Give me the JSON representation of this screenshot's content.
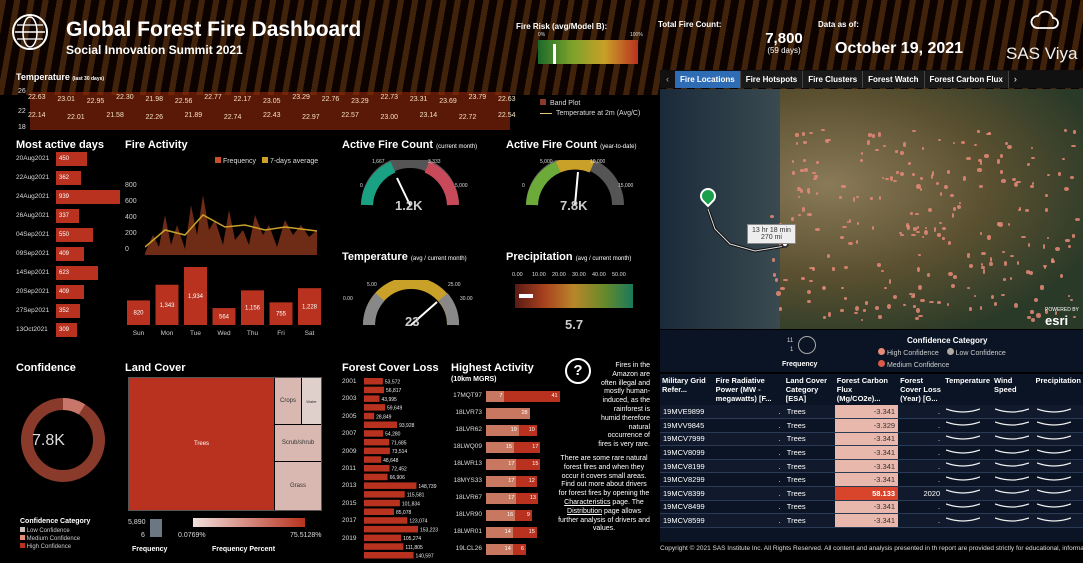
{
  "header": {
    "title": "Global Forest Fire Dashboard",
    "subtitle": "Social Innovation Summit 2021",
    "risk_label": "Fire Risk (avg/Model B):",
    "risk_min": "0%",
    "risk_max": "100%",
    "count_label": "Total Fire Count:",
    "count_value": "7,800",
    "count_days": "(59 days)",
    "date_label": "Data as of:",
    "date_value": "October 19, 2021",
    "brand": "SAS Viya"
  },
  "temp_band": {
    "title": "Temperature",
    "note": "(last 30 days)",
    "y_ticks": [
      "26",
      "22",
      "18"
    ],
    "upper": [
      "22.63",
      "23.01",
      "22.95",
      "22.30",
      "21.98",
      "22.56",
      "22.77",
      "22.17",
      "23.05",
      "23.29",
      "22.76",
      "23.29",
      "22.73",
      "23.31",
      "23.69",
      "23.79",
      "22.63"
    ],
    "lower": [
      "22.14",
      "22.01",
      "21.58",
      "22.26",
      "21.89",
      "22.74",
      "22.43",
      "22.97",
      "22.57",
      "23.00",
      "23.14",
      "22.72",
      "22.54"
    ],
    "legend": [
      "Band Plot",
      "Temperature at 2m (Avg/C)"
    ]
  },
  "most_active": {
    "title": "Most active days",
    "rows": [
      [
        "20Aug2021",
        "450"
      ],
      [
        "22Aug2021",
        "362"
      ],
      [
        "24Aug2021",
        "939"
      ],
      [
        "26Aug2021",
        "337"
      ],
      [
        "04Sep2021",
        "550"
      ],
      [
        "09Sep2021",
        "409"
      ],
      [
        "14Sep2021",
        "623"
      ],
      [
        "20Sep2021",
        "409"
      ],
      [
        "27Sep2021",
        "352"
      ],
      [
        "13Oct2021",
        "309"
      ]
    ]
  },
  "fire_activity": {
    "title": "Fire Activity",
    "legend": [
      "Frequency",
      "7-days average"
    ],
    "y_ticks": [
      "800",
      "600",
      "400",
      "200",
      "0"
    ],
    "days": [
      "Sun",
      "Mon",
      "Tue",
      "Wed",
      "Thu",
      "Fri",
      "Sat"
    ],
    "values": [
      820,
      1343,
      1934,
      564,
      1156,
      755,
      1228
    ],
    "labels": [
      "820",
      "1,343",
      "1,934",
      "564",
      "1,156",
      "755",
      "1,228"
    ]
  },
  "gauges": {
    "fire_month": {
      "title": "Active Fire Count",
      "sub": "(current month)",
      "ticks": [
        "0",
        "1,667",
        "3,333",
        "5,000"
      ],
      "value": "1.2K"
    },
    "fire_ytd": {
      "title": "Active Fire Count",
      "sub": "(year-to-date)",
      "ticks": [
        "0",
        "5,000",
        "10,000",
        "15,000"
      ],
      "value": "7.8K"
    },
    "temp": {
      "title": "Temperature",
      "sub": "(avg / current month)",
      "ticks": [
        "0.00",
        "5.00",
        "25.00",
        "30.00"
      ],
      "value": "23"
    },
    "precip": {
      "title": "Precipitation",
      "sub": "(avg / current month)",
      "ticks": [
        "0.00",
        "10.00",
        "20.00",
        "30.00",
        "40.00",
        "50.00"
      ],
      "value": "5.7"
    }
  },
  "tabs": [
    "Fire Locations",
    "Fire Hotspots",
    "Fire Clusters",
    "Forest Watch",
    "Forest Carbon Flux"
  ],
  "map": {
    "route_time": "13 hr 18 min",
    "route_dist": "270 mi",
    "esri": "esri",
    "powered": "POWERED BY"
  },
  "confidence_legend": {
    "title": "Confidence Category",
    "items": [
      "High Confidence",
      "Low Confidence",
      "Medium Confidence"
    ],
    "freq": "Frequency",
    "ticks": [
      "11",
      "1"
    ]
  },
  "confidence": {
    "title": "Confidence",
    "value": "7.8K",
    "legend_title": "Confidence Category",
    "items": [
      "Low Confidence",
      "Medium Confidence",
      "High Confidence"
    ]
  },
  "land_cover": {
    "title": "Land Cover",
    "cells": [
      "Trees",
      "Crops",
      "Water",
      "Scrub/shrub",
      "Grass"
    ],
    "freq_max": "5,890",
    "freq_min": "6",
    "pct_min": "0.0769%",
    "pct_max": "75.5128%",
    "freq_label": "Frequency",
    "pct_label": "Frequency Percent"
  },
  "forest_loss": {
    "title": "Forest Cover Loss",
    "years": [
      "2001",
      "2003",
      "2005",
      "2007",
      "2009",
      "2011",
      "2013",
      "2015",
      "2017",
      "2019"
    ],
    "values": [
      "53,572",
      "56,817",
      "43,995",
      "59,649",
      "28,849",
      "93,928",
      "54,280",
      "71,685",
      "73,514",
      "48,648",
      "72,452",
      "66,906",
      "148,739",
      "115,581",
      "101,834",
      "85,078",
      "123,074",
      "153,223",
      "105,274",
      "111,805",
      "140,597"
    ]
  },
  "highest": {
    "title": "Highest Activity",
    "sub": "(10km MGRS)",
    "rows": [
      [
        "17MQT97",
        "7",
        "41"
      ],
      [
        "18LVR73",
        "28",
        ""
      ],
      [
        "18LVR62",
        "19",
        "10"
      ],
      [
        "18LWQ09",
        "15",
        "17"
      ],
      [
        "18LWR13",
        "17",
        "15"
      ],
      [
        "18MYS33",
        "17",
        "12"
      ],
      [
        "18LVR67",
        "17",
        "13"
      ],
      [
        "18LVR90",
        "16",
        "9"
      ],
      [
        "18LWR01",
        "14",
        "15"
      ],
      [
        "19LCL26",
        "14",
        "6"
      ]
    ]
  },
  "info": {
    "text1": "Fires in the Amazon are often illegal and mostly human-induced, as the rainforest is humid therefore natural occurrence of fires is very rare.",
    "text2a": "There are some rare natural forest fires and when they occur it covers small areas. Find out more about drivers for forest fires by opening the",
    "link1": "Characteristics",
    "text2b": "page. The",
    "link2": "Distribution",
    "text2c": "page allows further analysis of drivers and values."
  },
  "table": {
    "headers": [
      "Military Grid Refer...",
      "Fire Radiative Power (MW - megawatts) [F...",
      "Land Cover Category [ESA]",
      "Forest Carbon Flux (Mg/CO2e)...",
      "Forest Cover Loss (Year) [G...",
      "Temperature",
      "Wind Speed",
      "Precipitation"
    ],
    "rows": [
      [
        "19MVE9899",
        ".",
        "Trees",
        "-3.341",
        "."
      ],
      [
        "19MVV9845",
        ".",
        "Trees",
        "-3.329",
        "."
      ],
      [
        "19MCV7999",
        ".",
        "Trees",
        "-3.341",
        "."
      ],
      [
        "19MCV8099",
        ".",
        "Trees",
        "-3.341",
        "."
      ],
      [
        "19MCV8199",
        ".",
        "Trees",
        "-3.341",
        "."
      ],
      [
        "19MCV8299",
        ".",
        "Trees",
        "-3.341",
        "."
      ],
      [
        "19MCV8399",
        ".",
        "Trees",
        "58.133",
        "2020"
      ],
      [
        "19MCV8499",
        ".",
        "Trees",
        "-3.341",
        "."
      ],
      [
        "19MCV8599",
        ".",
        "Trees",
        "-3.341",
        "."
      ]
    ]
  },
  "footer": "Copyright © 2021 SAS Institute Inc. All Rights Reserved. All content and analysis presented in th report are provided strictly for educational, informational, and demonstration purposes onl"
}
